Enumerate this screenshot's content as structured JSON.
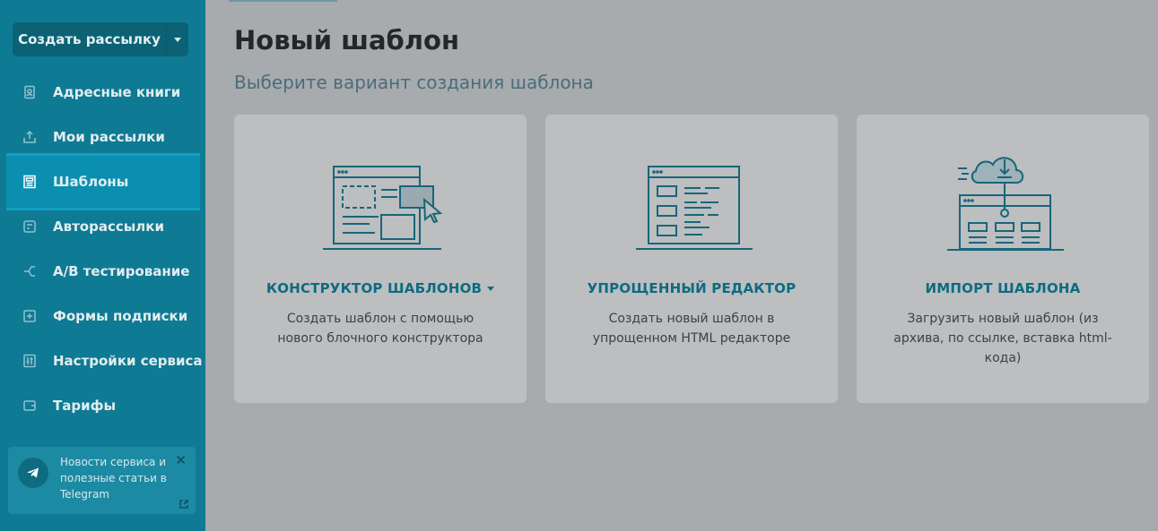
{
  "sidebar": {
    "create_button": "Создать рассылку",
    "items": [
      {
        "label": "Адресные книги",
        "icon": "address-book-icon"
      },
      {
        "label": "Мои рассылки",
        "icon": "outbox-icon"
      },
      {
        "label": "Шаблоны",
        "icon": "template-icon",
        "active": true
      },
      {
        "label": "Авторассылки",
        "icon": "automation-icon"
      },
      {
        "label": "A/B тестирование",
        "icon": "ab-test-icon"
      },
      {
        "label": "Формы подписки",
        "icon": "form-icon"
      },
      {
        "label": "Настройки сервиса",
        "icon": "settings-sliders-icon"
      },
      {
        "label": "Тарифы",
        "icon": "wallet-icon"
      }
    ],
    "telegram": {
      "text": "Новости сервиса и полезные статьи в Telegram",
      "close": "✕"
    }
  },
  "main": {
    "title": "Новый шаблон",
    "subtitle": "Выберите вариант создания шаблона",
    "cards": [
      {
        "title": "КОНСТРУКТОР ШАБЛОНОВ",
        "description": "Создать шаблон с помощью нового блочного конструктора",
        "icon": "template-builder-icon"
      },
      {
        "title": "УПРОЩЕННЫЙ РЕДАКТОР",
        "description": "Создать новый шаблон в упрощенном HTML редакторе",
        "icon": "simple-editor-icon"
      },
      {
        "title": "ИМПОРТ ШАБЛОНА",
        "description": "Загрузить новый шаблон (из архива, по ссылке, вставка html-кода)",
        "icon": "cloud-import-icon"
      }
    ]
  },
  "colors": {
    "sidebar": "#0f7a93",
    "accent": "#0d6b82",
    "background": "#a7abad"
  }
}
